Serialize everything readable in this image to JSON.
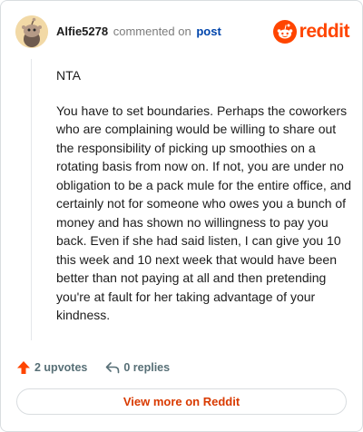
{
  "header": {
    "author": "Alfie5278",
    "action_text": "commented on",
    "post_link": "post",
    "brand_name": "reddit",
    "brand_color": "#ff4500",
    "avatar_icon": "snoo-avatar-icon"
  },
  "comment": {
    "paragraphs": [
      "NTA",
      "You have to set boundaries. Perhaps the coworkers who are complaining would be willing to share out the responsibility of picking up smoothies on a rotating basis from now on. If not, you are under no obligation to be a pack mule for the entire office, and certainly not for someone who owes you a bunch of money and has shown no willingness to pay you back. Even if she had said listen, I can give you 10 this week and 10 next week that would have been better than not paying at all and then pretending you're at fault for her taking advantage of your kindness."
    ]
  },
  "actions": {
    "upvotes_label": "2 upvotes",
    "replies_label": "0 replies",
    "upvote_icon": "upvote-arrow-icon",
    "reply_icon": "reply-icon",
    "upvote_color": "#ff4500"
  },
  "footer": {
    "view_more_label": "View more on Reddit",
    "view_more_color": "#d93a00"
  }
}
